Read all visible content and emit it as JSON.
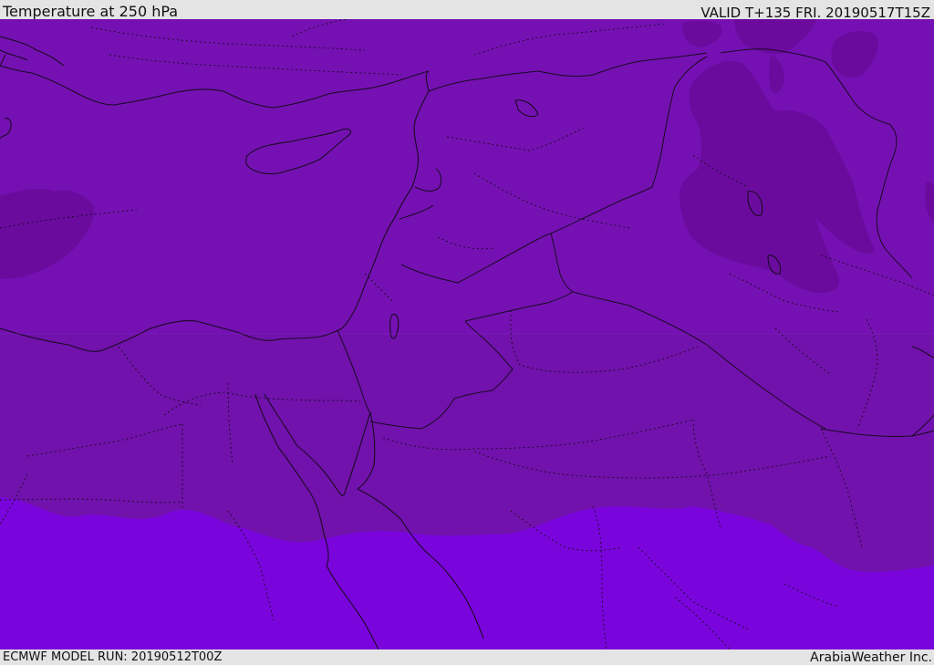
{
  "header": {
    "title": "Temperature at 250 hPa",
    "valid": "VALID T+135 FRI. 20190517T15Z"
  },
  "footer": {
    "model_run": "ECMWF MODEL RUN: 20190512T00Z",
    "credit": "ArabiaWeather Inc."
  },
  "map": {
    "colors": {
      "base_purple": "#7511b3",
      "dark_purple": "#6a0b9e",
      "bright_violet": "#7a05dc",
      "mid_purple": "#7110ad",
      "outline": "#1a0a22"
    }
  }
}
